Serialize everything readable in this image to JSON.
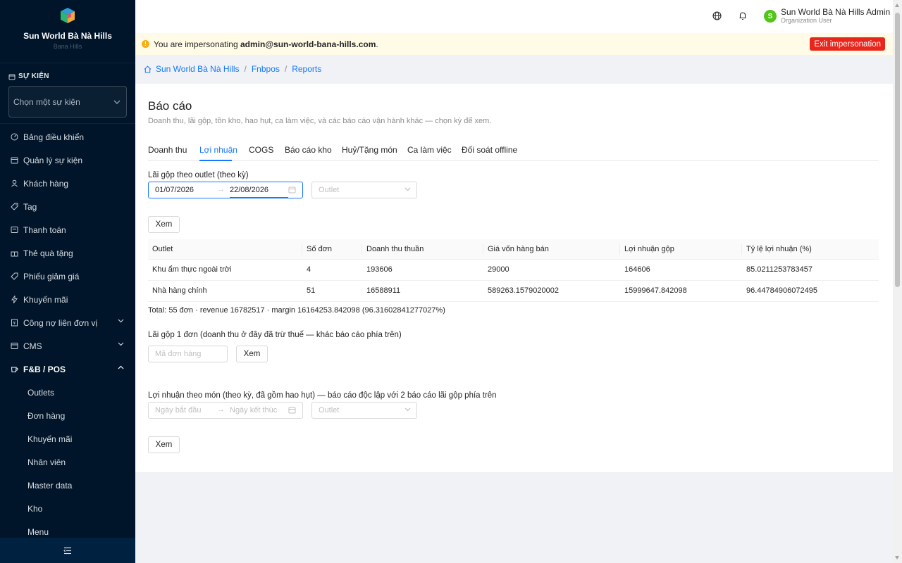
{
  "sidebar": {
    "brand_name": "Sun World Bà Nà Hills",
    "brand_sub": "Bana Hills",
    "section_label": "SỰ KIỆN",
    "event_placeholder": "Chọn một sự kiện",
    "menu": [
      {
        "label": "Bảng điều khiển",
        "icon": "dashboard-icon"
      },
      {
        "label": "Quản lý sự kiện",
        "icon": "calendar-icon"
      },
      {
        "label": "Khách hàng",
        "icon": "user-icon"
      },
      {
        "label": "Tag",
        "icon": "tag-icon"
      },
      {
        "label": "Thanh toán",
        "icon": "payment-icon"
      },
      {
        "label": "Thẻ quà tặng",
        "icon": "gift-icon"
      },
      {
        "label": "Phiếu giảm giá",
        "icon": "coupon-icon"
      },
      {
        "label": "Khuyến mãi",
        "icon": "flash-icon"
      },
      {
        "label": "Công nợ liên đơn vị",
        "icon": "ledger-icon"
      },
      {
        "label": "CMS",
        "icon": "cms-icon"
      },
      {
        "label": "F&B / POS",
        "icon": "coffee-icon"
      }
    ],
    "submenu": [
      "Outlets",
      "Đơn hàng",
      "Khuyến mãi",
      "Nhân viên",
      "Master data",
      "Kho",
      "Menu"
    ]
  },
  "header": {
    "user_name": "Sun World Bà Nà Hills Admin",
    "user_role": "Organization User",
    "avatar_letter": "S"
  },
  "banner": {
    "prefix": "You are impersonating ",
    "email": "admin@sun-world-bana-hills.com",
    "suffix": ".",
    "exit_label": "Exit impersonation"
  },
  "breadcrumb": [
    "Sun World Bà Nà Hills",
    "Fnbpos",
    "Reports"
  ],
  "page": {
    "title": "Báo cáo",
    "description": "Doanh thu, lãi gộp, tồn kho, hao hụt, ca làm việc, và các báo cáo vận hành khác — chọn kỳ để xem.",
    "tabs": [
      "Doanh thu",
      "Lợi nhuận",
      "COGS",
      "Báo cáo kho",
      "Huỷ/Tặng món",
      "Ca làm việc",
      "Đối soát offline"
    ],
    "active_tab": "Lợi nhuận"
  },
  "section1": {
    "title": "Lãi gộp theo outlet (theo kỳ)",
    "date_from": "01/07/2026",
    "date_to": "22/08/2026",
    "outlet_placeholder": "Outlet",
    "view_label": "Xem"
  },
  "table": {
    "headers": [
      "Outlet",
      "Số đơn",
      "Doanh thu thuần",
      "Giá vốn hàng bán",
      "Lợi nhuận gộp",
      "Tỷ lệ lợi nhuận (%)"
    ],
    "rows": [
      [
        "Khu ẩm thực ngoài trời",
        "4",
        "193606",
        "29000",
        "164606",
        "85.0211253783457"
      ],
      [
        "Nhà hàng chính",
        "51",
        "16588911",
        "589263.1579020002",
        "15999647.842098",
        "96.44784906072495"
      ]
    ],
    "total": "Total: 55 đơn · revenue 16782517 · margin 16164253.842098 (96.31602841277027%)"
  },
  "section2": {
    "title": "Lãi gộp 1 đơn (doanh thu ở đây đã trừ thuế — khác báo cáo phía trên)",
    "order_placeholder": "Mã đơn hàng",
    "view_label": "Xem"
  },
  "section3": {
    "title": "Lợi nhuận theo món (theo kỳ, đã gồm hao hụt) — báo cáo độc lập với 2 báo cáo lãi gộp phía trên",
    "start_placeholder": "Ngày bắt đầu",
    "end_placeholder": "Ngày kết thúc",
    "outlet_placeholder": "Outlet",
    "view_label": "Xem"
  },
  "colors": {
    "sidebar_bg": "#001529",
    "primary": "#1677ff",
    "danger": "#e8261b",
    "banner_bg": "#fffbe6"
  }
}
